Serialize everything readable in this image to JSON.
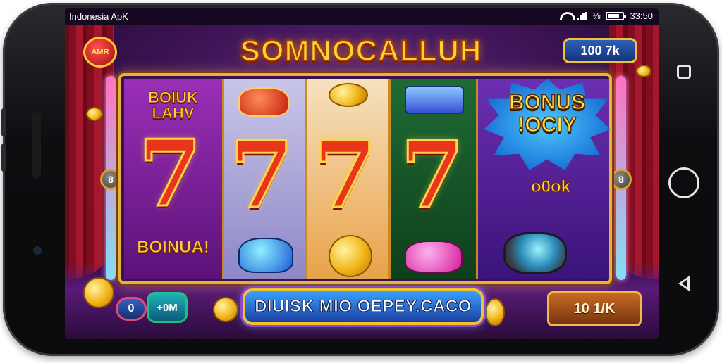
{
  "status_bar": {
    "app_title": "Indonesia ApK",
    "battery_text": "⅛",
    "time": "33:50"
  },
  "game": {
    "title": "SOMNOCALLUH",
    "left_badge": "AMR",
    "top_balance": "100 7k",
    "reel1_top_label": "BOIUK\nLAHV",
    "reel1_bottom_label": "BOINUA!",
    "sevens": [
      "7",
      "7",
      "7",
      "7"
    ],
    "bonus_label": "BONUS\n!OCIY",
    "bonus_value": "o0ok",
    "left_knob": "8",
    "right_knob": "8",
    "bottom_left_value": "0",
    "add_button": "+0M",
    "spin_banner": "DIUISK MIO OEPEY.CACO",
    "bet_value": "10 1/K"
  },
  "colors": {
    "gold": "#ffd23a",
    "frame": "#e7b23a",
    "seven_red": "#e8351c",
    "bg_purple": "#3b1352"
  }
}
